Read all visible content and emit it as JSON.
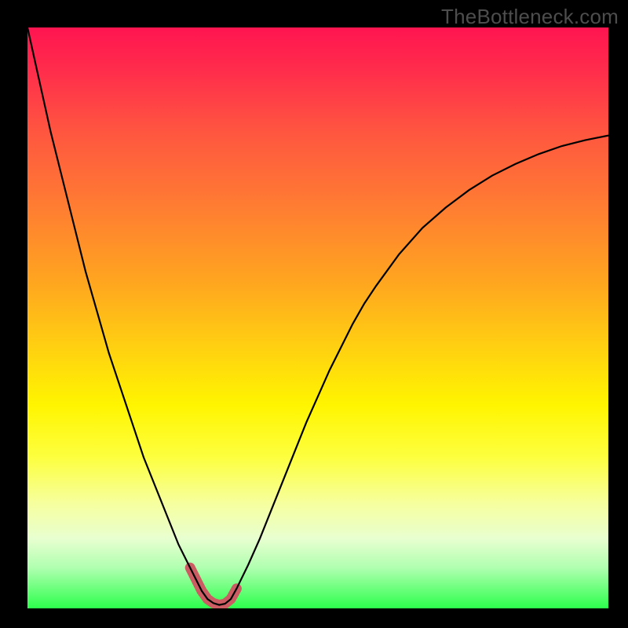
{
  "watermark": "TheBottleneck.com",
  "chart_data": {
    "type": "line",
    "title": "",
    "xlabel": "",
    "ylabel": "",
    "xlim": [
      0,
      100
    ],
    "ylim": [
      0,
      100
    ],
    "grid": false,
    "marker_range_x": [
      27,
      36
    ],
    "series": [
      {
        "name": "curve",
        "x": [
          0,
          2,
          4,
          6,
          8,
          10,
          12,
          14,
          16,
          18,
          20,
          22,
          24,
          26,
          28,
          29,
          30,
          31,
          32,
          33,
          34,
          35,
          36,
          38,
          40,
          42,
          44,
          46,
          48,
          50,
          52,
          54,
          56,
          58,
          60,
          64,
          68,
          72,
          76,
          80,
          84,
          88,
          92,
          96,
          100
        ],
        "y": [
          100,
          91,
          82,
          74,
          66,
          58,
          51,
          44,
          38,
          32,
          26,
          21,
          16,
          11,
          7,
          5,
          3,
          1.6,
          0.9,
          0.6,
          0.8,
          1.6,
          3.4,
          7.5,
          12,
          17,
          22,
          27,
          32,
          36.5,
          41,
          45,
          49,
          52.5,
          55.5,
          61,
          65.5,
          69,
          72,
          74.5,
          76.5,
          78.2,
          79.6,
          80.6,
          81.4
        ]
      }
    ]
  }
}
